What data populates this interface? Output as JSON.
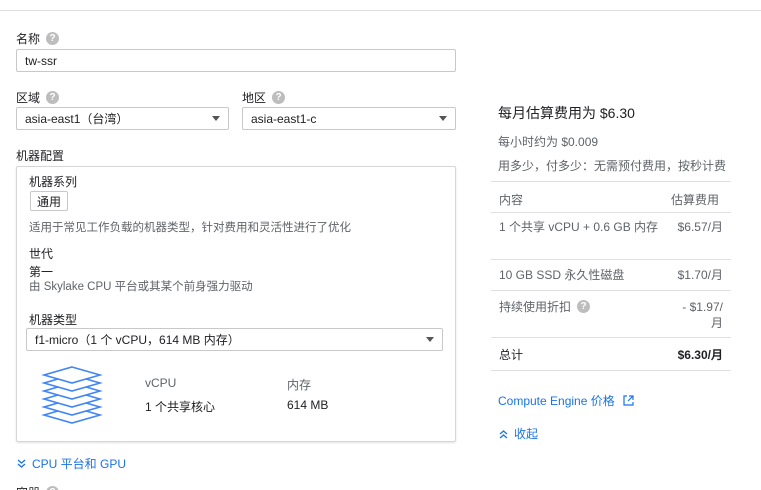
{
  "name": {
    "label": "名称",
    "value": "tw-ssr"
  },
  "region": {
    "label": "区域",
    "value": "asia-east1（台湾）"
  },
  "zone": {
    "label": "地区",
    "value": "asia-east1-c"
  },
  "machine_config": {
    "label": "机器配置",
    "family_label": "机器系列",
    "family_tab": "通用",
    "family_desc": "适用于常见工作负载的机器类型，针对费用和灵活性进行了优化",
    "generation_label": "世代",
    "generation_value": "第一",
    "generation_desc": "由 Skylake CPU 平台或其某个前身强力驱动",
    "type_label": "机器类型",
    "type_value": "f1-micro（1 个 vCPU，614 MB 内存）",
    "vcpu_label": "vCPU",
    "vcpu_value": "1 个共享核心",
    "memory_label": "内存",
    "memory_value": "614 MB"
  },
  "cpu_gpu_link": "CPU 平台和 GPU",
  "cutoff_label": "容器",
  "pricing": {
    "title": "每月估算费用为 $6.30",
    "hourly": "每小时约为 $0.009",
    "note": "用多少，付多少：无需预付费用，按秒计费",
    "col_item": "内容",
    "col_cost": "估算费用",
    "rows": [
      {
        "item": "1 个共享 vCPU + 0.6 GB 内存",
        "cost": "$6.57/月"
      },
      {
        "item": "10 GB SSD 永久性磁盘",
        "cost": "$1.70/月"
      },
      {
        "item": "持续使用折扣",
        "cost": "- $1.97/月"
      }
    ],
    "total_label": "总计",
    "total_value": "$6.30/月",
    "engine_link": "Compute Engine 价格",
    "collapse": "收起"
  },
  "colors": {
    "accent": "#1a73e8",
    "border": "#c8c8c8",
    "muted": "#5f6368"
  }
}
